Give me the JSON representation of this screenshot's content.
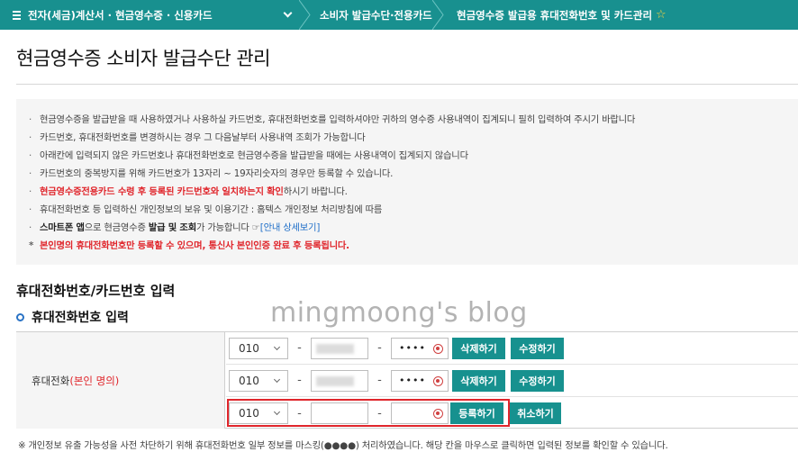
{
  "breadcrumb": {
    "seg1": "전자(세금)계산서 · 현금영수증 · 신용카드",
    "seg2": "소비자 발급수단·전용카드",
    "seg3": "현금영수증 발급용 휴대전화번호 및 카드관리",
    "star": "☆"
  },
  "page_title": "현금영수증 소비자 발급수단 관리",
  "notice": {
    "bullet": "·",
    "items": [
      "현금영수증을 발급받을 때 사용하였거나 사용하실 카드번호, 휴대전화번호를 입력하셔야만 귀하의 영수증 사용내역이 집계되니 필히 입력하여 주시기 바랍니다",
      "카드번호, 휴대전화번호를 변경하시는 경우 그 다음날부터 사용내역 조회가 가능합니다",
      "아래칸에 입력되지 않은 카드번호나 휴대전화번호로 현금영수증을 발급받을 때에는 사용내역이 집계되지 않습니다",
      "카드번호의 중복방지를 위해 카드번호가 13자리 ~ 19자리숫자의 경우만 등록할 수 있습니다."
    ],
    "item5_red": "현금영수증전용카드 수령 후 등록된 카드번호와 일치하는지 확인",
    "item5_rest": "하시기 바랍니다.",
    "item6": "휴대전화번호 등 입력하신 개인정보의 보유 및 이용기간 : 홈텍스 개인정보 처리방침에 따름",
    "item7_bold1": "스마트폰 앱",
    "item7_t1": "으로 현금영수증 ",
    "item7_bold2": "발급 및 조회",
    "item7_t2": "가 가능합니다 ☞",
    "item7_link": "[안내 상세보기]",
    "item8_star": "*",
    "item8": "본인명의 휴대전화번호만 등록할 수 있으며, 통신사 본인인증 완료 후 등록됩니다."
  },
  "section_title": "휴대전화번호/카드번호 입력",
  "subsection_title": "휴대전화번호 입력",
  "watermark": "mingmoong's blog",
  "table": {
    "header": "휴대전화",
    "header_note": "(본인 명의)",
    "dash": "-",
    "rows": [
      {
        "prefix": "010",
        "middle": "",
        "last": "••••",
        "btn1": "삭제하기",
        "btn2": "수정하기"
      },
      {
        "prefix": "010",
        "middle": "",
        "last": "••••",
        "btn1": "삭제하기",
        "btn2": "수정하기"
      },
      {
        "prefix": "010",
        "middle": "",
        "last": "",
        "btn1": "등록하기",
        "btn2": "취소하기"
      }
    ]
  },
  "footnote": "※ 개인정보 유출 가능성을 사전 차단하기 위해 휴대전화번호 일부 정보를 마스킹(●●●●) 처리하였습니다. 해당 칸을 마우스로 클릭하면 입력된 정보를 확인할 수 있습니다.",
  "colors": {
    "accent": "#18908f",
    "warning": "#e0262c",
    "link": "#1e6ec8"
  }
}
